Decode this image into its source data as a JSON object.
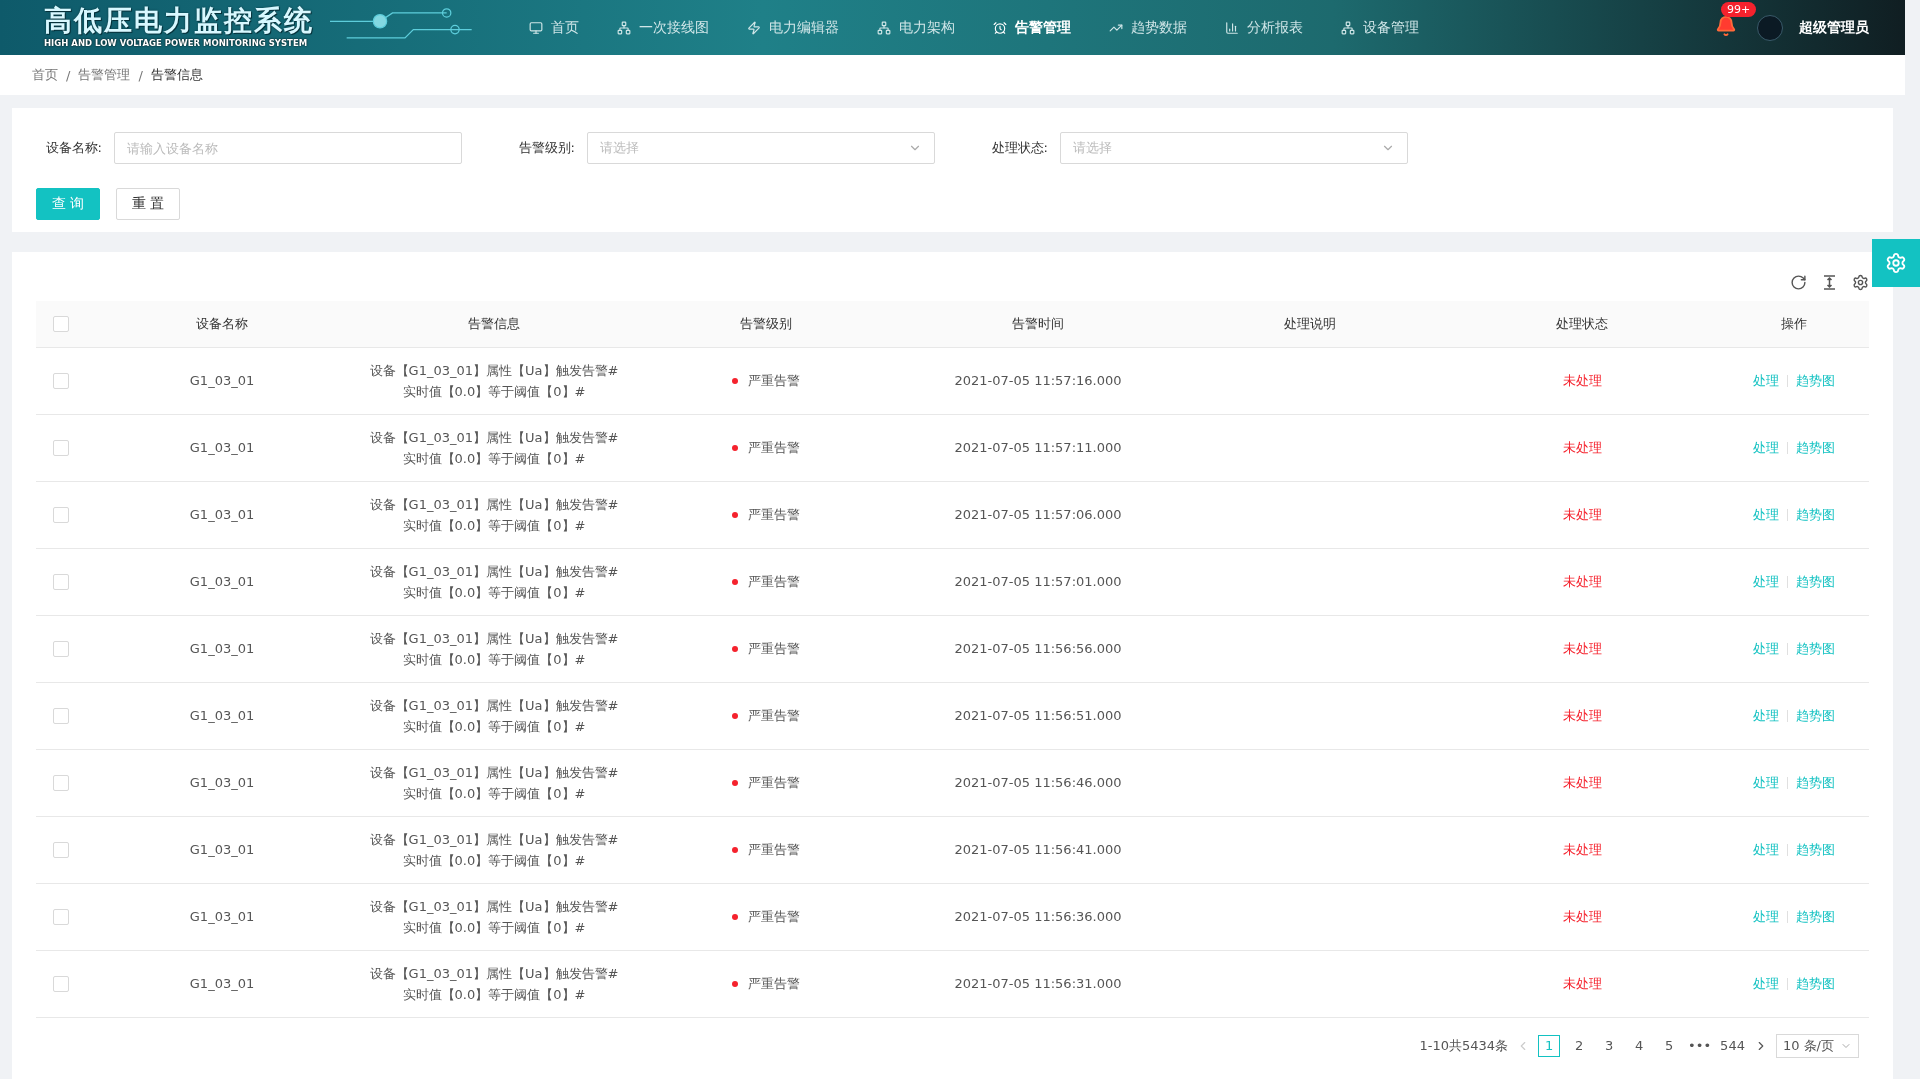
{
  "header": {
    "title": "高低压电力监控系统",
    "subtitle": "HIGH AND LOW VOLTAGE POWER MONITORING SYSTEM",
    "nav": [
      {
        "label": "首页",
        "kind": "monitor",
        "selected": false
      },
      {
        "label": "一次接线图",
        "kind": "network",
        "selected": false
      },
      {
        "label": "电力编辑器",
        "kind": "bolt",
        "selected": false
      },
      {
        "label": "电力架构",
        "kind": "network",
        "selected": false
      },
      {
        "label": "告警管理",
        "kind": "alarm",
        "selected": true
      },
      {
        "label": "趋势数据",
        "kind": "trend",
        "selected": false
      },
      {
        "label": "分析报表",
        "kind": "chart",
        "selected": false
      },
      {
        "label": "设备管理",
        "kind": "network",
        "selected": false
      }
    ],
    "badge": "99+",
    "user": "超级管理员"
  },
  "breadcrumb": [
    {
      "label": "首页"
    },
    {
      "separator": "/",
      "label": "告警管理"
    },
    {
      "separator": "/",
      "label": "告警信息"
    }
  ],
  "filters": [
    {
      "label": "设备名称:",
      "placeholder": "请输入设备名称",
      "kind": "input"
    },
    {
      "label": "告警级别:",
      "placeholder": "请选择",
      "kind": "select"
    },
    {
      "label": "处理状态:",
      "placeholder": "请选择",
      "kind": "select"
    }
  ],
  "buttons": [
    {
      "label": "查 询",
      "kind": "primary"
    },
    {
      "label": "重 置",
      "kind": "default"
    }
  ],
  "table": {
    "columns": [
      "设备名称",
      "告警信息",
      "告警级别",
      "告警时间",
      "处理说明",
      "处理状态",
      "操作"
    ],
    "select_all": {
      "checked": false
    },
    "rows": [
      {
        "checked": false,
        "device": "G1_03_01",
        "info": [
          "设备【G1_03_01】属性【Ua】触发告警#",
          "实时值【0.0】等于阈值【0】#"
        ],
        "level": "严重告警",
        "color": "#f5222d",
        "time": "2021-07-05 11:57:16.000",
        "status": "未处理",
        "actions": [
          "处理",
          "趋势图"
        ]
      },
      {
        "checked": false,
        "device": "G1_03_01",
        "info": [
          "设备【G1_03_01】属性【Ua】触发告警#",
          "实时值【0.0】等于阈值【0】#"
        ],
        "level": "严重告警",
        "color": "#f5222d",
        "time": "2021-07-05 11:57:11.000",
        "status": "未处理",
        "actions": [
          "处理",
          "趋势图"
        ]
      },
      {
        "checked": false,
        "device": "G1_03_01",
        "info": [
          "设备【G1_03_01】属性【Ua】触发告警#",
          "实时值【0.0】等于阈值【0】#"
        ],
        "level": "严重告警",
        "color": "#f5222d",
        "time": "2021-07-05 11:57:06.000",
        "status": "未处理",
        "actions": [
          "处理",
          "趋势图"
        ]
      },
      {
        "checked": false,
        "device": "G1_03_01",
        "info": [
          "设备【G1_03_01】属性【Ua】触发告警#",
          "实时值【0.0】等于阈值【0】#"
        ],
        "level": "严重告警",
        "color": "#f5222d",
        "time": "2021-07-05 11:57:01.000",
        "status": "未处理",
        "actions": [
          "处理",
          "趋势图"
        ]
      },
      {
        "checked": false,
        "device": "G1_03_01",
        "info": [
          "设备【G1_03_01】属性【Ua】触发告警#",
          "实时值【0.0】等于阈值【0】#"
        ],
        "level": "严重告警",
        "color": "#f5222d",
        "time": "2021-07-05 11:56:56.000",
        "status": "未处理",
        "actions": [
          "处理",
          "趋势图"
        ]
      },
      {
        "checked": false,
        "device": "G1_03_01",
        "info": [
          "设备【G1_03_01】属性【Ua】触发告警#",
          "实时值【0.0】等于阈值【0】#"
        ],
        "level": "严重告警",
        "color": "#f5222d",
        "time": "2021-07-05 11:56:51.000",
        "status": "未处理",
        "actions": [
          "处理",
          "趋势图"
        ]
      },
      {
        "checked": false,
        "device": "G1_03_01",
        "info": [
          "设备【G1_03_01】属性【Ua】触发告警#",
          "实时值【0.0】等于阈值【0】#"
        ],
        "level": "严重告警",
        "color": "#f5222d",
        "time": "2021-07-05 11:56:46.000",
        "status": "未处理",
        "actions": [
          "处理",
          "趋势图"
        ]
      },
      {
        "checked": false,
        "device": "G1_03_01",
        "info": [
          "设备【G1_03_01】属性【Ua】触发告警#",
          "实时值【0.0】等于阈值【0】#"
        ],
        "level": "严重告警",
        "color": "#f5222d",
        "time": "2021-07-05 11:56:41.000",
        "status": "未处理",
        "actions": [
          "处理",
          "趋势图"
        ]
      },
      {
        "checked": false,
        "device": "G1_03_01",
        "info": [
          "设备【G1_03_01】属性【Ua】触发告警#",
          "实时值【0.0】等于阈值【0】#"
        ],
        "level": "严重告警",
        "color": "#f5222d",
        "time": "2021-07-05 11:56:36.000",
        "status": "未处理",
        "actions": [
          "处理",
          "趋势图"
        ]
      },
      {
        "checked": false,
        "device": "G1_03_01",
        "info": [
          "设备【G1_03_01】属性【Ua】触发告警#",
          "实时值【0.0】等于阈值【0】#"
        ],
        "level": "严重告警",
        "color": "#f5222d",
        "time": "2021-07-05 11:56:31.000",
        "status": "未处理",
        "actions": [
          "处理",
          "趋势图"
        ]
      }
    ]
  },
  "pagination": {
    "total": "1-10共5434条",
    "pages": [
      {
        "label": "1",
        "selected": true
      },
      {
        "label": "2",
        "selected": false
      },
      {
        "label": "3",
        "selected": false
      },
      {
        "label": "4",
        "selected": false
      },
      {
        "label": "5",
        "selected": false
      }
    ],
    "ellipsis": "•••",
    "last": "544",
    "page_size": "10 条/页"
  }
}
